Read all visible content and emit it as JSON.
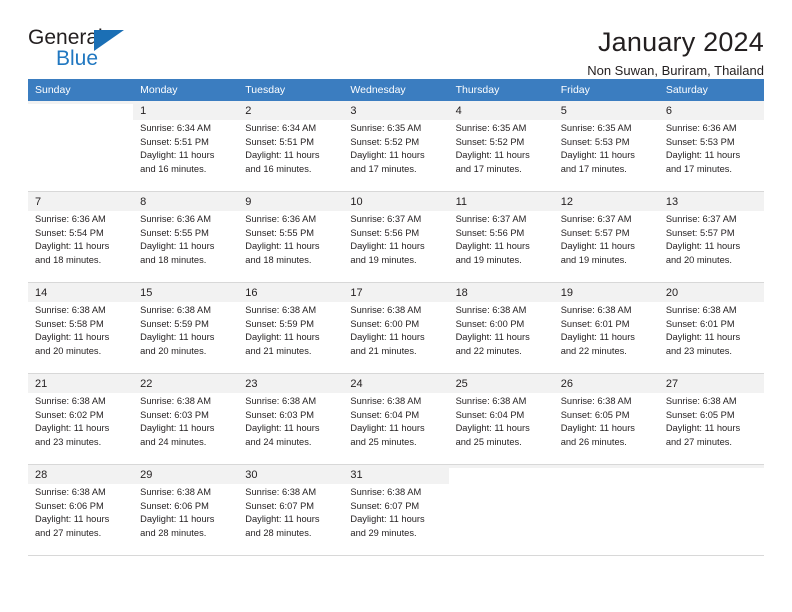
{
  "logo": {
    "word_dark": "General",
    "word_blue": "Blue",
    "triangle_icon": "triangle-icon",
    "brand_blue": "#2077c0",
    "brand_dark": "#231f20"
  },
  "header": {
    "title": "January 2024",
    "subtitle": "Non Suwan, Buriram, Thailand"
  },
  "calendar": {
    "header_bg": "#3b7dc0",
    "header_text_color": "#ffffff",
    "weekdays": [
      "Sunday",
      "Monday",
      "Tuesday",
      "Wednesday",
      "Thursday",
      "Friday",
      "Saturday"
    ],
    "weeks": [
      [
        {
          "day": "",
          "lines": []
        },
        {
          "day": "1",
          "lines": [
            "Sunrise: 6:34 AM",
            "Sunset: 5:51 PM",
            "Daylight: 11 hours",
            "and 16 minutes."
          ]
        },
        {
          "day": "2",
          "lines": [
            "Sunrise: 6:34 AM",
            "Sunset: 5:51 PM",
            "Daylight: 11 hours",
            "and 16 minutes."
          ]
        },
        {
          "day": "3",
          "lines": [
            "Sunrise: 6:35 AM",
            "Sunset: 5:52 PM",
            "Daylight: 11 hours",
            "and 17 minutes."
          ]
        },
        {
          "day": "4",
          "lines": [
            "Sunrise: 6:35 AM",
            "Sunset: 5:52 PM",
            "Daylight: 11 hours",
            "and 17 minutes."
          ]
        },
        {
          "day": "5",
          "lines": [
            "Sunrise: 6:35 AM",
            "Sunset: 5:53 PM",
            "Daylight: 11 hours",
            "and 17 minutes."
          ]
        },
        {
          "day": "6",
          "lines": [
            "Sunrise: 6:36 AM",
            "Sunset: 5:53 PM",
            "Daylight: 11 hours",
            "and 17 minutes."
          ]
        }
      ],
      [
        {
          "day": "7",
          "lines": [
            "Sunrise: 6:36 AM",
            "Sunset: 5:54 PM",
            "Daylight: 11 hours",
            "and 18 minutes."
          ]
        },
        {
          "day": "8",
          "lines": [
            "Sunrise: 6:36 AM",
            "Sunset: 5:55 PM",
            "Daylight: 11 hours",
            "and 18 minutes."
          ]
        },
        {
          "day": "9",
          "lines": [
            "Sunrise: 6:36 AM",
            "Sunset: 5:55 PM",
            "Daylight: 11 hours",
            "and 18 minutes."
          ]
        },
        {
          "day": "10",
          "lines": [
            "Sunrise: 6:37 AM",
            "Sunset: 5:56 PM",
            "Daylight: 11 hours",
            "and 19 minutes."
          ]
        },
        {
          "day": "11",
          "lines": [
            "Sunrise: 6:37 AM",
            "Sunset: 5:56 PM",
            "Daylight: 11 hours",
            "and 19 minutes."
          ]
        },
        {
          "day": "12",
          "lines": [
            "Sunrise: 6:37 AM",
            "Sunset: 5:57 PM",
            "Daylight: 11 hours",
            "and 19 minutes."
          ]
        },
        {
          "day": "13",
          "lines": [
            "Sunrise: 6:37 AM",
            "Sunset: 5:57 PM",
            "Daylight: 11 hours",
            "and 20 minutes."
          ]
        }
      ],
      [
        {
          "day": "14",
          "lines": [
            "Sunrise: 6:38 AM",
            "Sunset: 5:58 PM",
            "Daylight: 11 hours",
            "and 20 minutes."
          ]
        },
        {
          "day": "15",
          "lines": [
            "Sunrise: 6:38 AM",
            "Sunset: 5:59 PM",
            "Daylight: 11 hours",
            "and 20 minutes."
          ]
        },
        {
          "day": "16",
          "lines": [
            "Sunrise: 6:38 AM",
            "Sunset: 5:59 PM",
            "Daylight: 11 hours",
            "and 21 minutes."
          ]
        },
        {
          "day": "17",
          "lines": [
            "Sunrise: 6:38 AM",
            "Sunset: 6:00 PM",
            "Daylight: 11 hours",
            "and 21 minutes."
          ]
        },
        {
          "day": "18",
          "lines": [
            "Sunrise: 6:38 AM",
            "Sunset: 6:00 PM",
            "Daylight: 11 hours",
            "and 22 minutes."
          ]
        },
        {
          "day": "19",
          "lines": [
            "Sunrise: 6:38 AM",
            "Sunset: 6:01 PM",
            "Daylight: 11 hours",
            "and 22 minutes."
          ]
        },
        {
          "day": "20",
          "lines": [
            "Sunrise: 6:38 AM",
            "Sunset: 6:01 PM",
            "Daylight: 11 hours",
            "and 23 minutes."
          ]
        }
      ],
      [
        {
          "day": "21",
          "lines": [
            "Sunrise: 6:38 AM",
            "Sunset: 6:02 PM",
            "Daylight: 11 hours",
            "and 23 minutes."
          ]
        },
        {
          "day": "22",
          "lines": [
            "Sunrise: 6:38 AM",
            "Sunset: 6:03 PM",
            "Daylight: 11 hours",
            "and 24 minutes."
          ]
        },
        {
          "day": "23",
          "lines": [
            "Sunrise: 6:38 AM",
            "Sunset: 6:03 PM",
            "Daylight: 11 hours",
            "and 24 minutes."
          ]
        },
        {
          "day": "24",
          "lines": [
            "Sunrise: 6:38 AM",
            "Sunset: 6:04 PM",
            "Daylight: 11 hours",
            "and 25 minutes."
          ]
        },
        {
          "day": "25",
          "lines": [
            "Sunrise: 6:38 AM",
            "Sunset: 6:04 PM",
            "Daylight: 11 hours",
            "and 25 minutes."
          ]
        },
        {
          "day": "26",
          "lines": [
            "Sunrise: 6:38 AM",
            "Sunset: 6:05 PM",
            "Daylight: 11 hours",
            "and 26 minutes."
          ]
        },
        {
          "day": "27",
          "lines": [
            "Sunrise: 6:38 AM",
            "Sunset: 6:05 PM",
            "Daylight: 11 hours",
            "and 27 minutes."
          ]
        }
      ],
      [
        {
          "day": "28",
          "lines": [
            "Sunrise: 6:38 AM",
            "Sunset: 6:06 PM",
            "Daylight: 11 hours",
            "and 27 minutes."
          ]
        },
        {
          "day": "29",
          "lines": [
            "Sunrise: 6:38 AM",
            "Sunset: 6:06 PM",
            "Daylight: 11 hours",
            "and 28 minutes."
          ]
        },
        {
          "day": "30",
          "lines": [
            "Sunrise: 6:38 AM",
            "Sunset: 6:07 PM",
            "Daylight: 11 hours",
            "and 28 minutes."
          ]
        },
        {
          "day": "31",
          "lines": [
            "Sunrise: 6:38 AM",
            "Sunset: 6:07 PM",
            "Daylight: 11 hours",
            "and 29 minutes."
          ]
        },
        {
          "day": "",
          "lines": []
        },
        {
          "day": "",
          "lines": []
        },
        {
          "day": "",
          "lines": []
        }
      ]
    ]
  }
}
